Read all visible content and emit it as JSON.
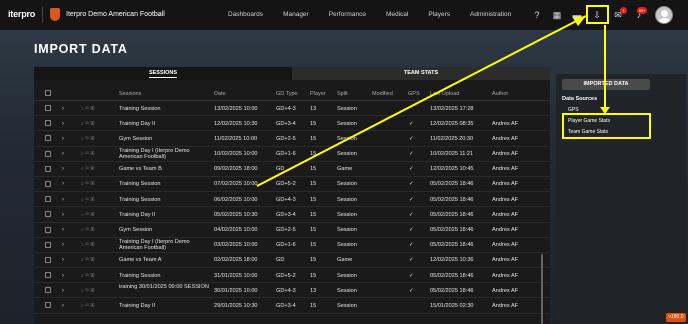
{
  "topnav": {
    "logo": "iterpro",
    "club_name": "Iterpro Demo American Football",
    "links": [
      "Dashboards",
      "Manager",
      "Performance",
      "Medical",
      "Players",
      "Administration"
    ],
    "icons": [
      "help-icon",
      "calendar-icon",
      "folder-icon",
      "import-icon",
      "chat-icon",
      "bell-icon"
    ],
    "chat_badge": "1",
    "bell_badge": "99+"
  },
  "page": {
    "title": "IMPORT DATA"
  },
  "tabs": {
    "sessions": "SESSIONS",
    "team_stats": "TEAM STATS"
  },
  "table": {
    "headers": {
      "sessions": "Sessions",
      "date": "Date",
      "gd_type": "GD Type",
      "player": "Player",
      "split": "Split",
      "modified": "Modified",
      "gps": "GPS",
      "last_upload": "Last Upload",
      "author": "Author"
    },
    "rows": [
      {
        "session": "Training Session",
        "date": "13/02/2025 10:00",
        "gd": "GD+4-3",
        "player": "13",
        "split": "Session",
        "gps": "",
        "upload": "13/02/2025 17:28",
        "author": ""
      },
      {
        "session": "Training Day II",
        "date": "12/02/2025 10:30",
        "gd": "GD+3-4",
        "player": "15",
        "split": "Session",
        "gps": "✓",
        "upload": "12/02/2025 08:35",
        "author": "Andres AF"
      },
      {
        "session": "Gym Session",
        "date": "11/02/2025 10:00",
        "gd": "GD+2-5",
        "player": "15",
        "split": "Session",
        "gps": "✓",
        "upload": "11/02/2025 20:30",
        "author": "Andres AF"
      },
      {
        "session": "Training Day I (Iterpro Demo American Football)",
        "date": "10/02/2025 10:00",
        "gd": "GD+1-6",
        "player": "15",
        "split": "Session",
        "gps": "✓",
        "upload": "10/02/2025 11:21",
        "author": "Andres AF"
      },
      {
        "session": "Game vs Team B",
        "date": "09/02/2025 18:00",
        "gd": "GD",
        "player": "15",
        "split": "Game",
        "gps": "✓",
        "upload": "12/02/2025 10:45",
        "author": "Andres AF"
      },
      {
        "session": "Training Session",
        "date": "07/02/2025 10:00",
        "gd": "GD+5-2",
        "player": "15",
        "split": "Session",
        "gps": "✓",
        "upload": "05/02/2025 18:46",
        "author": "Andres AF"
      },
      {
        "session": "Training Session",
        "date": "06/02/2025 10:00",
        "gd": "GD+4-3",
        "player": "15",
        "split": "Session",
        "gps": "✓",
        "upload": "05/02/2025 18:46",
        "author": "Andres AF"
      },
      {
        "session": "Training Day II",
        "date": "05/02/2025 10:30",
        "gd": "GD+3-4",
        "player": "15",
        "split": "Session",
        "gps": "✓",
        "upload": "05/02/2025 18:46",
        "author": "Andres AF"
      },
      {
        "session": "Gym Session",
        "date": "04/02/2025 10:00",
        "gd": "GD+2-5",
        "player": "15",
        "split": "Session",
        "gps": "✓",
        "upload": "05/02/2025 18:46",
        "author": "Andres AF"
      },
      {
        "session": "Training Day I (Iterpro Demo American Football)",
        "date": "03/02/2025 10:00",
        "gd": "GD+1-6",
        "player": "15",
        "split": "Session",
        "gps": "✓",
        "upload": "05/02/2025 18:46",
        "author": "Andres AF"
      },
      {
        "session": "Game vs Team A",
        "date": "02/02/2025 18:00",
        "gd": "GD",
        "player": "15",
        "split": "Game",
        "gps": "✓",
        "upload": "12/02/2025 10:36",
        "author": "Andres AF"
      },
      {
        "session": "Training Session",
        "date": "31/01/2025 10:00",
        "gd": "GD+5-2",
        "player": "15",
        "split": "Session",
        "gps": "✓",
        "upload": "05/02/2025 18:46",
        "author": "Andres AF"
      },
      {
        "session": "training 30/01/2025 09:00 SESSION",
        "date": "30/01/2025 10:00",
        "gd": "GD+4-3",
        "player": "13",
        "split": "Session",
        "gps": "✓",
        "upload": "05/02/2025 18:46",
        "author": "Andres AF"
      },
      {
        "session": "Training Day II",
        "date": "29/01/2025 10:30",
        "gd": "GD+3-4",
        "player": "15",
        "split": "Session",
        "gps": "",
        "upload": "15/01/2025 02:30",
        "author": "Andres AF"
      }
    ]
  },
  "side": {
    "imported_button": "IMPORTED DATA",
    "sources_label": "Data Sources",
    "items": [
      "GPS",
      "Player Game Stats",
      "Team Game Stats"
    ]
  },
  "version": "v180.0",
  "colors": {
    "annotation": "#ffff00",
    "badge": "#e02020",
    "version": "#e05010"
  }
}
